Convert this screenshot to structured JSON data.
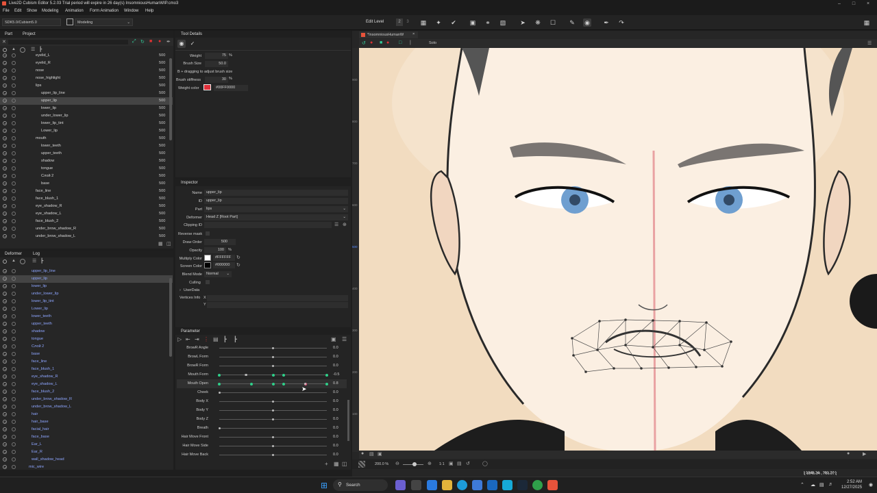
{
  "title_bar": {
    "text": "Live2D Cubism Editor 5.2.03   Trial period will expire in 26 day(s)   InsomniousHumanWIP.cmo3"
  },
  "menu": [
    "File",
    "Edit",
    "Show",
    "Modeling",
    "Animation",
    "Form Animation",
    "Window",
    "Help"
  ],
  "toolbar": {
    "sdk_select": "SDK5.0/Cubism5.0",
    "mode_select": "Modeling",
    "edit_level_label": "Edit Level",
    "edit_level_values": [
      "2",
      "3"
    ]
  },
  "part_panel": {
    "tabs": [
      "Part",
      "Project"
    ],
    "rows": [
      {
        "name": "eyelid_L",
        "value": "500",
        "indent": 52
      },
      {
        "name": "eyelid_R",
        "value": "500",
        "indent": 52
      },
      {
        "name": "nose",
        "value": "500",
        "indent": 52
      },
      {
        "name": "nose_highlight",
        "value": "500",
        "indent": 52
      },
      {
        "name": "lips",
        "value": "500",
        "indent": 52
      },
      {
        "name": "upper_lip_line",
        "value": "500",
        "indent": 60
      },
      {
        "name": "upper_lip",
        "value": "500",
        "indent": 60,
        "selected": true
      },
      {
        "name": "lower_lip",
        "value": "500",
        "indent": 60
      },
      {
        "name": "under_lower_lip",
        "value": "500",
        "indent": 60
      },
      {
        "name": "lower_lip_tint",
        "value": "500",
        "indent": 60
      },
      {
        "name": "Lower_lip",
        "value": "500",
        "indent": 60
      },
      {
        "name": "mouth",
        "value": "500",
        "indent": 52
      },
      {
        "name": "lower_teeth",
        "value": "500",
        "indent": 60
      },
      {
        "name": "upper_teeth",
        "value": "500",
        "indent": 60
      },
      {
        "name": "shadow",
        "value": "500",
        "indent": 60
      },
      {
        "name": "tongue",
        "value": "500",
        "indent": 60
      },
      {
        "name": "Слой 2",
        "value": "500",
        "indent": 60
      },
      {
        "name": "base",
        "value": "500",
        "indent": 60
      },
      {
        "name": "face_line",
        "value": "500",
        "indent": 52
      },
      {
        "name": "face_blush_1",
        "value": "500",
        "indent": 52
      },
      {
        "name": "eye_shadow_R",
        "value": "500",
        "indent": 52
      },
      {
        "name": "eye_shadow_L",
        "value": "500",
        "indent": 52
      },
      {
        "name": "face_blush_2",
        "value": "500",
        "indent": 52
      },
      {
        "name": "under_brow_shadow_R",
        "value": "500",
        "indent": 52
      },
      {
        "name": "under_brow_shadow_L",
        "value": "500",
        "indent": 52
      }
    ]
  },
  "deformer_panel": {
    "tabs": [
      "Deformer",
      "Log"
    ],
    "rows": [
      {
        "name": "upper_lip_line",
        "indent": 46
      },
      {
        "name": "upper_lip",
        "indent": 46,
        "selected": true
      },
      {
        "name": "lower_lip",
        "indent": 46
      },
      {
        "name": "under_lower_lip",
        "indent": 46
      },
      {
        "name": "lower_lip_tint",
        "indent": 46
      },
      {
        "name": "Lower_lip",
        "indent": 46
      },
      {
        "name": "lower_teeth",
        "indent": 46
      },
      {
        "name": "upper_teeth",
        "indent": 46
      },
      {
        "name": "shadow",
        "indent": 46
      },
      {
        "name": "tongue",
        "indent": 46
      },
      {
        "name": "Слой 2",
        "indent": 46
      },
      {
        "name": "base",
        "indent": 46
      },
      {
        "name": "face_line",
        "indent": 46
      },
      {
        "name": "face_blush_1",
        "indent": 46
      },
      {
        "name": "eye_shadow_R",
        "indent": 46
      },
      {
        "name": "eye_shadow_L",
        "indent": 46
      },
      {
        "name": "face_blush_2",
        "indent": 46
      },
      {
        "name": "under_brow_shadow_R",
        "indent": 46
      },
      {
        "name": "under_brow_shadow_L",
        "indent": 46
      },
      {
        "name": "hair",
        "indent": 46
      },
      {
        "name": "hair_base",
        "indent": 46
      },
      {
        "name": "facial_hair",
        "indent": 46
      },
      {
        "name": "face_base",
        "indent": 46
      },
      {
        "name": "Ear_L",
        "indent": 46
      },
      {
        "name": "Ear_R",
        "indent": 46
      },
      {
        "name": "wall_shadow_head",
        "indent": 46
      },
      {
        "name": "mic_wire",
        "indent": 42
      }
    ]
  },
  "tool_details": {
    "title": "Tool Details",
    "weight_label": "Weight",
    "weight_value": "75",
    "weight_unit": "%",
    "brush_size_label": "Brush Size",
    "brush_size_value": "50.0",
    "hint": "B + dragging to adjust brush size",
    "stiffness_label": "Brush stiffness",
    "stiffness_value": "30",
    "stiffness_unit": "%",
    "weight_color_label": "Weight color",
    "weight_color_value": "#00FF0000",
    "weight_color_swatch": "#e0303a"
  },
  "inspector": {
    "title": "Inspector",
    "fields": [
      {
        "label": "Name",
        "value": "upper_lip"
      },
      {
        "label": "ID",
        "value": "upper_lip"
      },
      {
        "label": "Part",
        "value": "lips"
      },
      {
        "label": "Deformer",
        "value": "Head Z  [Root Part]"
      },
      {
        "label": "Clipping ID",
        "value": ""
      }
    ],
    "reverse_mask_label": "Reverse mask",
    "draw_order_label": "Draw Order",
    "draw_order_value": "500",
    "opacity_label": "Opacity",
    "opacity_value": "100",
    "opacity_unit": "%",
    "multiply_label": "Multiply Color",
    "multiply_value": "#FFFFFF",
    "screen_label": "Screen Color",
    "screen_value": "#000000",
    "blend_label": "Blend Mode",
    "blend_value": "Normal",
    "culling_label": "Culling",
    "userdata_label": "UserData",
    "vertices_label": "Vertices Info",
    "vx_label": "X",
    "vy_label": "Y"
  },
  "parameter": {
    "title": "Parameter",
    "rows": [
      {
        "name": "BrowR Angle",
        "value": "0.0",
        "knob": 0.5,
        "keys": []
      },
      {
        "name": "BrowL Form",
        "value": "0.0",
        "knob": 0.5,
        "keys": []
      },
      {
        "name": "BrowR Form",
        "value": "0.0",
        "knob": 0.5,
        "keys": []
      },
      {
        "name": "Mouth Form",
        "value": "-0.5",
        "knob": 0.25,
        "keys": [
          0,
          0.25,
          0.5,
          0.6,
          1
        ]
      },
      {
        "name": "Mouth Open",
        "value": "0.8",
        "knob": 0.8,
        "keys": [
          0,
          0.3,
          0.5,
          0.6,
          0.8,
          1
        ],
        "active": true
      },
      {
        "name": "Cheek",
        "value": "0.0",
        "knob": 0,
        "keys": []
      },
      {
        "name": "Body X",
        "value": "0.0",
        "knob": 0.5,
        "keys": []
      },
      {
        "name": "Body Y",
        "value": "0.0",
        "knob": 0.5,
        "keys": []
      },
      {
        "name": "Body Z",
        "value": "0.0",
        "knob": 0.5,
        "keys": []
      },
      {
        "name": "Breath",
        "value": "0.0",
        "knob": 0,
        "keys": []
      },
      {
        "name": "Hair Move Front",
        "value": "0.0",
        "knob": 0.5,
        "keys": []
      },
      {
        "name": "Hair Move Side",
        "value": "0.0",
        "knob": 0.5,
        "keys": []
      },
      {
        "name": "Hair Move Back",
        "value": "0.0",
        "knob": 0.5,
        "keys": []
      }
    ]
  },
  "canvas": {
    "tab_label": "*InsomniousHumanW",
    "solo_label": "Solo",
    "ruler_labels": [
      "900",
      "800",
      "700",
      "600",
      "500",
      "400",
      "300",
      "200",
      "100"
    ],
    "zoom_value": "200.0 %",
    "ratio_label": "1:1",
    "coords": "[ 1845.34 , 781.27 ]"
  },
  "taskbar": {
    "search_label": "Search",
    "time": "2:52 AM",
    "date": "12/27/2025"
  }
}
